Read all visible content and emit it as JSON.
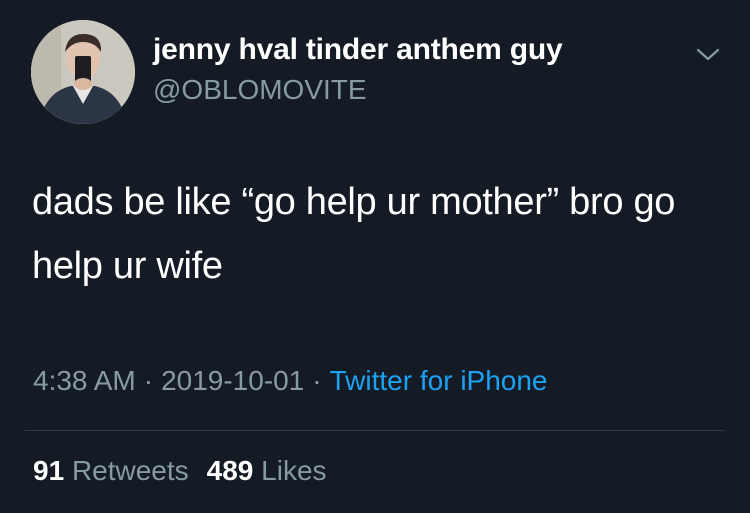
{
  "user": {
    "display_name": "jenny hval tinder anthem guy",
    "handle": "@OBLOMOVITE",
    "avatar_icon": "profile-photo"
  },
  "tweet": {
    "text": "dads be like “go help ur mother” bro go help ur wife",
    "time": "4:38 AM",
    "date": "2019-10-01",
    "separator": "·",
    "source": "Twitter for iPhone"
  },
  "stats": {
    "retweets_count": "91",
    "retweets_label": "Retweets",
    "likes_count": "489",
    "likes_label": "Likes"
  },
  "colors": {
    "background": "#141b24",
    "text": "#ffffff",
    "secondary": "#8899a6",
    "link": "#1da1f2"
  },
  "icons": {
    "menu": "chevron-down-icon"
  }
}
